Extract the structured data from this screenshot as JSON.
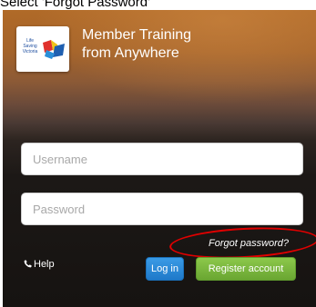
{
  "caption": "Select 'Forgot Password'",
  "header": {
    "logo_lines": [
      "Life",
      "Saving",
      "Victoria"
    ],
    "title_line1": "Member Training",
    "title_line2": "from Anywhere"
  },
  "form": {
    "username_placeholder": "Username",
    "password_placeholder": "Password",
    "forgot_label": "Forgot password?"
  },
  "footer": {
    "help_label": "Help",
    "login_label": "Log in",
    "register_label": "Register account"
  },
  "colors": {
    "login_blue": "#1f79c9",
    "register_green": "#6aa632",
    "annotation_red": "#e00000"
  },
  "icons": {
    "help": "phone-icon"
  }
}
